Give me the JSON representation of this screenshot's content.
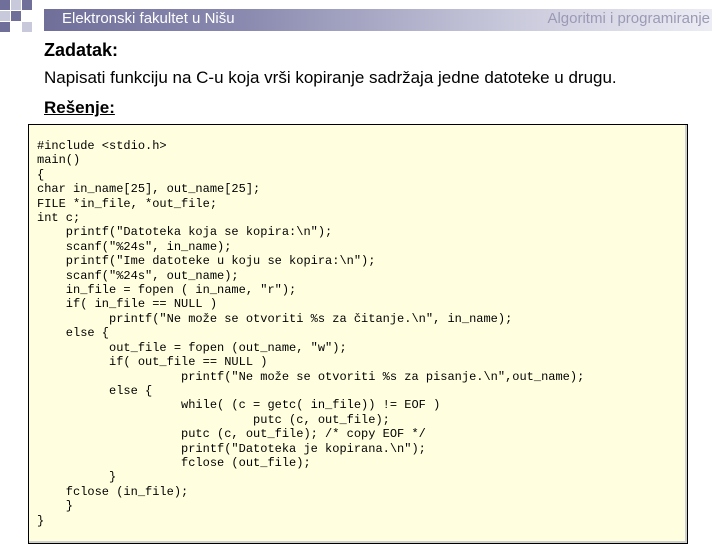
{
  "header": {
    "left_title": "Elektronski fakultet u Nišu",
    "right_title": "Algoritmi i programiranje"
  },
  "task": {
    "label": "Zadatak:",
    "text": "Napisati funkciju na C-u koja vrši kopiranje sadržaja jedne datoteke u drugu."
  },
  "solution": {
    "label": "Rešenje:"
  },
  "code_lines": [
    "#include <stdio.h>",
    "main()",
    "{",
    "char in_name[25], out_name[25];",
    "FILE *in_file, *out_file;",
    "int c;",
    "    printf(\"Datoteka koja se kopira:\\n\");",
    "    scanf(\"%24s\", in_name);",
    "    printf(\"Ime datoteke u koju se kopira:\\n\");",
    "    scanf(\"%24s\", out_name);",
    "    in_file = fopen ( in_name, \"r\");",
    "    if( in_file == NULL )",
    "          printf(\"Ne može se otvoriti %s za čitanje.\\n\", in_name);",
    "    else {",
    "          out_file = fopen (out_name, \"w\");",
    "          if( out_file == NULL )",
    "                    printf(\"Ne može se otvoriti %s za pisanje.\\n\",out_name);",
    "          else {",
    "                    while( (c = getc( in_file)) != EOF )",
    "                              putc (c, out_file);",
    "                    putc (c, out_file); /* copy EOF */",
    "                    printf(\"Datoteka je kopirana.\\n\");",
    "                    fclose (out_file);",
    "          }",
    "    fclose (in_file);",
    "    }",
    "}"
  ],
  "colors": {
    "header_band": "#8a8ab0",
    "code_background": "#ffffe0",
    "logo_purple": "#6f6f9a",
    "logo_light": "#c9c9dc"
  }
}
